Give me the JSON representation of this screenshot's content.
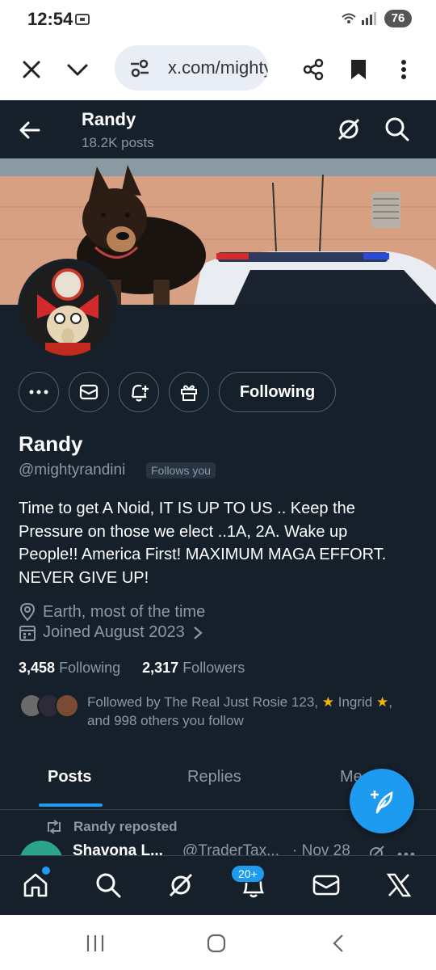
{
  "status": {
    "time": "12:54",
    "battery": "76"
  },
  "browser": {
    "url": "x.com/mightyrandini"
  },
  "header": {
    "name": "Randy",
    "posts": "18.2K posts"
  },
  "profile": {
    "follow_button": "Following",
    "name": "Randy",
    "handle": "@mightyrandini",
    "follows_you": "Follows you",
    "bio_lines": [
      "Time to get A Noid, IT IS UP TO US .. Keep the",
      "Pressure on those we elect ..1A, 2A. Wake up",
      "People!! America First! MAXIMUM MAGA EFFORT.",
      "NEVER GIVE UP!"
    ],
    "location": "Earth, most of the time",
    "joined": "Joined August 2023",
    "following_count": "3,458",
    "following_label": "Following",
    "followers_count": "2,317",
    "followers_label": "Followers",
    "followed_by": {
      "part1": "Followed by The Real Just Rosie 123,",
      "part2": "Ingrid",
      "part3": ", and 998 others you follow"
    }
  },
  "tabs": {
    "posts": "Posts",
    "replies": "Replies",
    "media": "Me"
  },
  "timeline": {
    "repost_label": "Randy reposted",
    "author_name": "Shavona L...",
    "author_handle": "@TraderTax...",
    "date": "· Nov 28"
  },
  "bottom_nav": {
    "notifications_badge": "20+"
  },
  "colors": {
    "background": "#15202b",
    "accent": "#1d9bf0",
    "muted": "#8b98a5"
  }
}
